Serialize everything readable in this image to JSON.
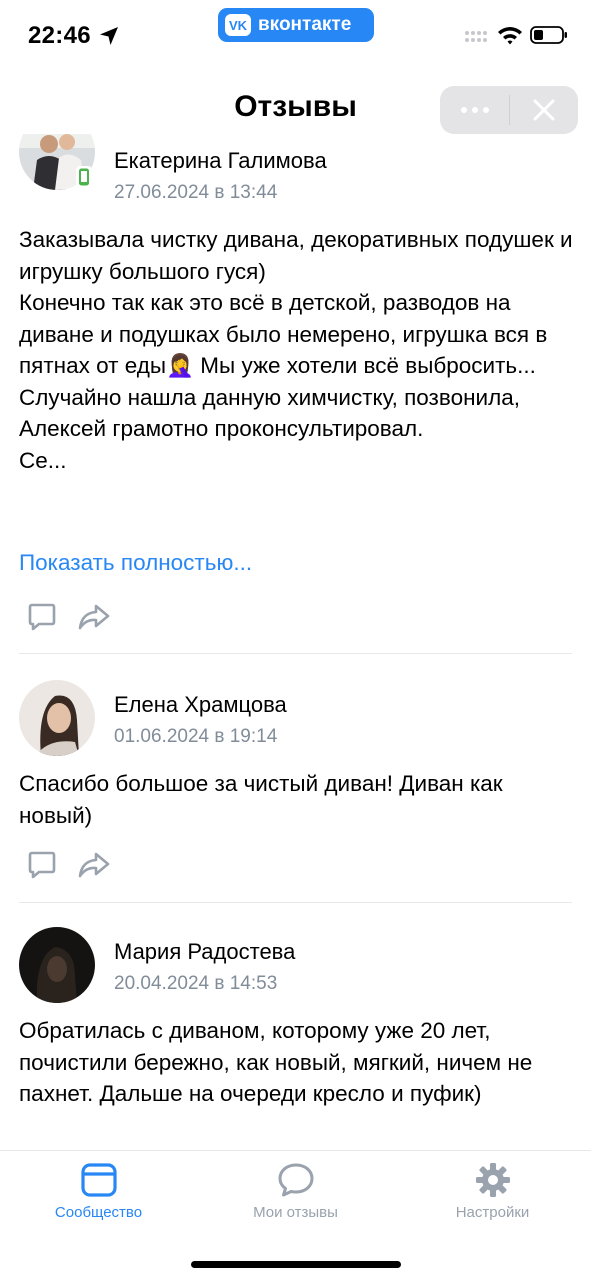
{
  "status": {
    "time": "22:46",
    "app_pill": "вконтакте",
    "app_logo": "VK"
  },
  "header": {
    "title": "Отзывы"
  },
  "reviews": [
    {
      "author": "Екатерина Галимова",
      "date": "27.06.2024 в 13:44",
      "text": "Заказывала чистку дивана, декоративных подушек и игрушку большого гуся)\nКонечно так как это всё в детской, разводов на диване и подушках было немерено, игрушка вся в пятнах от еды🤦‍♀️ Мы уже хотели всё выбросить...\nСлучайно нашла данную химчистку, позвонила, Алексей грамотно проконсультировал.\nСе...",
      "show_more": "Показать полностью..."
    },
    {
      "author": "Елена Храмцова",
      "date": "01.06.2024 в 19:14",
      "text": "Спасибо большое за чистый диван! Диван как новый)"
    },
    {
      "author": "Мария Радостева",
      "date": "20.04.2024 в 14:53",
      "text": "Обратилась с диваном, которому уже 20 лет, почистили бережно, как новый, мягкий, ничем не пахнет. Дальше на очереди кресло и пуфик)"
    }
  ],
  "tabs": [
    {
      "label": "Сообщество",
      "icon": "community-icon",
      "active": true
    },
    {
      "label": "Мои отзывы",
      "icon": "chat-bubble-icon",
      "active": false
    },
    {
      "label": "Настройки",
      "icon": "gear-icon",
      "active": false
    }
  ],
  "colors": {
    "accent": "#2787f5",
    "secondary_text": "#818c99",
    "inactive_tab": "#99a2ad"
  }
}
